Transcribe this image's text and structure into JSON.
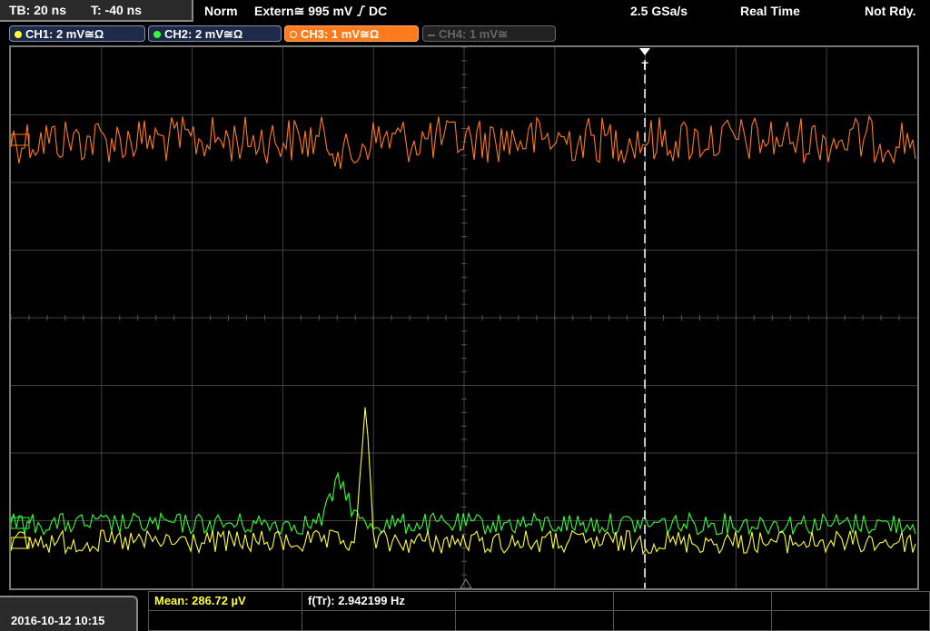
{
  "top": {
    "timebase": "TB: 20 ns",
    "trigger_offset": "T: -40 ns",
    "mode": "Norm",
    "trigger_source": "Extern",
    "trigger_coupling_icon": "≅",
    "trigger_level": "995 mV",
    "trigger_slope_icon": "rising-edge-icon",
    "trigger_dc": "DC",
    "sample_rate": "2.5 GSa/s",
    "acq_mode": "Real Time",
    "status": "Not Rdy."
  },
  "channels": [
    {
      "label": "CH1: 2 mV",
      "suffix": "≅Ω",
      "color": "#ffff33",
      "active": true
    },
    {
      "label": "CH2: 2 mV",
      "suffix": "≅Ω",
      "color": "#33ff33",
      "active": true
    },
    {
      "label": "CH3: 1 mV",
      "suffix": "≅Ω",
      "color": "#ff7a1a",
      "active": true,
      "selected": true
    },
    {
      "label": "CH4: 1 mV",
      "suffix": "≅",
      "color": "#666666",
      "active": false
    }
  ],
  "trigger_marker": "T",
  "bottom": {
    "datetime": "2016-10-12 10:15",
    "meas1": "Mean: 286.72 µV",
    "meas2": "f(Tr): 2.942199 Hz"
  },
  "colors": {
    "ch1": "#ffff33",
    "ch2": "#33ff33",
    "ch3": "#ff7a1a",
    "grid": "#404040"
  }
}
